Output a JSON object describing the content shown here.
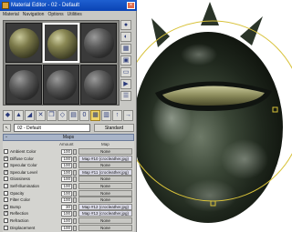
{
  "window": {
    "title": "Material Editor - 02 - Default",
    "close_symbol": "×",
    "menu": [
      "Material",
      "Navigation",
      "Options",
      "Utilities"
    ]
  },
  "slots": [
    {
      "kind": "reptile",
      "selected": false
    },
    {
      "kind": "reptile2",
      "selected": true
    },
    {
      "kind": "plain"
    },
    {
      "kind": "plain"
    },
    {
      "kind": "plain"
    },
    {
      "kind": "plain"
    }
  ],
  "sidebar_icons": [
    "sphere-preview-icon",
    "backlight-icon",
    "background-icon",
    "uv-tiling-icon",
    "video-check-icon",
    "make-preview-icon",
    "options-icon"
  ],
  "toolbar_icons": [
    "get-material-icon",
    "put-to-scene-icon",
    "assign-icon",
    "reset-icon",
    "copy-icon",
    "unique-icon",
    "put-library-icon",
    "material-id-icon",
    "show-map-icon",
    "show-end-icon",
    "go-parent-icon",
    "go-sibling-icon"
  ],
  "material": {
    "picker_glyph": "↖",
    "name": "02 - Default",
    "type": "Standard"
  },
  "maps": {
    "rollout_title": "Maps",
    "collapse_glyph": "-",
    "col_amount": "Amount",
    "col_map": "Map",
    "rows": [
      {
        "label": "Ambient Color",
        "checked": false,
        "amount": "100",
        "map": "None",
        "linked": true
      },
      {
        "label": "Diffuse Color",
        "checked": true,
        "amount": "100",
        "map": "Map #10 (crocleather.jpg)"
      },
      {
        "label": "Specular Color",
        "checked": false,
        "amount": "100",
        "map": "None"
      },
      {
        "label": "Specular Level",
        "checked": true,
        "amount": "100",
        "map": "Map #11 (crocleather.jpg)"
      },
      {
        "label": "Glossiness",
        "checked": false,
        "amount": "100",
        "map": "None"
      },
      {
        "label": "Self-Illumination",
        "checked": false,
        "amount": "100",
        "map": "None"
      },
      {
        "label": "Opacity",
        "checked": false,
        "amount": "100",
        "map": "None"
      },
      {
        "label": "Filter Color",
        "checked": false,
        "amount": "100",
        "map": "None"
      },
      {
        "label": "Bump",
        "checked": true,
        "amount": "30",
        "map": "Map #12 (crocleather.jpg)"
      },
      {
        "label": "Reflection",
        "checked": true,
        "amount": "100",
        "map": "Map #13 (crocleather.jpg)"
      },
      {
        "label": "Refraction",
        "checked": false,
        "amount": "100",
        "map": "None"
      },
      {
        "label": "Displacement",
        "checked": false,
        "amount": "100",
        "map": "None"
      }
    ]
  },
  "colors": {
    "titlebar": "#0a43b4",
    "gizmo": "#d8c23a",
    "leather_dark": "#1c241c",
    "leather_light": "#8a9a84"
  }
}
